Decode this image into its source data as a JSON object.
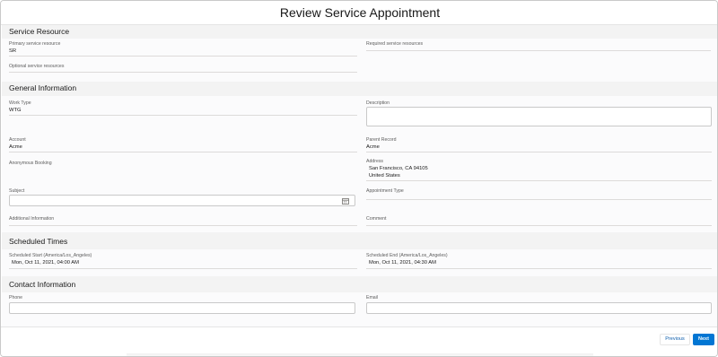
{
  "modal": {
    "title": "Review Service Appointment"
  },
  "sections": {
    "service_resource": {
      "title": "Service Resource",
      "primary_label": "Primary service resource",
      "primary_value": "SR",
      "required_label": "Required service resources",
      "optional_label": "Optional service resources"
    },
    "general": {
      "title": "General Information",
      "work_type_label": "Work Type",
      "work_type_value": "WTG",
      "description_label": "Description",
      "description_value": "",
      "account_label": "Account",
      "account_value": "Acme",
      "parent_label": "Parent Record",
      "parent_value": "Acme",
      "anonymous_label": "Anonymous Booking",
      "address_label": "Address",
      "address_line1": "San Francisco, CA 94105",
      "address_line2": "United States",
      "subject_label": "Subject",
      "subject_value": "",
      "appointment_type_label": "Appointment Type",
      "additional_label": "Additional Information",
      "comment_label": "Comment"
    },
    "scheduled": {
      "title": "Scheduled Times",
      "start_label": "Scheduled Start (America/Los_Angeles)",
      "start_value": "Mon, Oct 11, 2021, 04:00 AM",
      "end_label": "Scheduled End (America/Los_Angeles)",
      "end_value": "Mon, Oct 11, 2021, 04:30 AM"
    },
    "contact": {
      "title": "Contact Information",
      "phone_label": "Phone",
      "phone_value": "",
      "email_label": "Email",
      "email_value": ""
    }
  },
  "footer": {
    "previous_label": "Previous",
    "next_label": "Next"
  },
  "colors": {
    "brand": "#0176d3",
    "background": "#f3f3f3"
  }
}
